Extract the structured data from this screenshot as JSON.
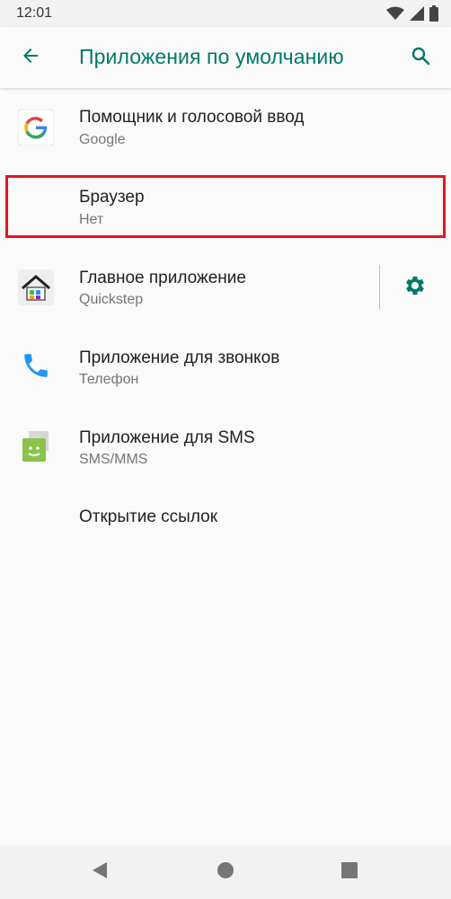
{
  "status_bar": {
    "time": "12:01"
  },
  "app_bar": {
    "title": "Приложения по умолчанию"
  },
  "items": [
    {
      "title": "Помощник и голосовой ввод",
      "subtitle": "Google",
      "icon": "google-icon"
    },
    {
      "title": "Браузер",
      "subtitle": "Нет",
      "icon": ""
    },
    {
      "title": "Главное приложение",
      "subtitle": "Quickstep",
      "icon": "home-app-icon"
    },
    {
      "title": "Приложение для звонков",
      "subtitle": "Телефон",
      "icon": "phone-icon"
    },
    {
      "title": "Приложение для SMS",
      "subtitle": "SMS/MMS",
      "icon": "sms-icon"
    },
    {
      "title": "Открытие ссылок",
      "subtitle": "",
      "icon": ""
    }
  ],
  "colors": {
    "accent": "#00796b",
    "highlight": "#e0181e",
    "background": "#fafafa"
  }
}
